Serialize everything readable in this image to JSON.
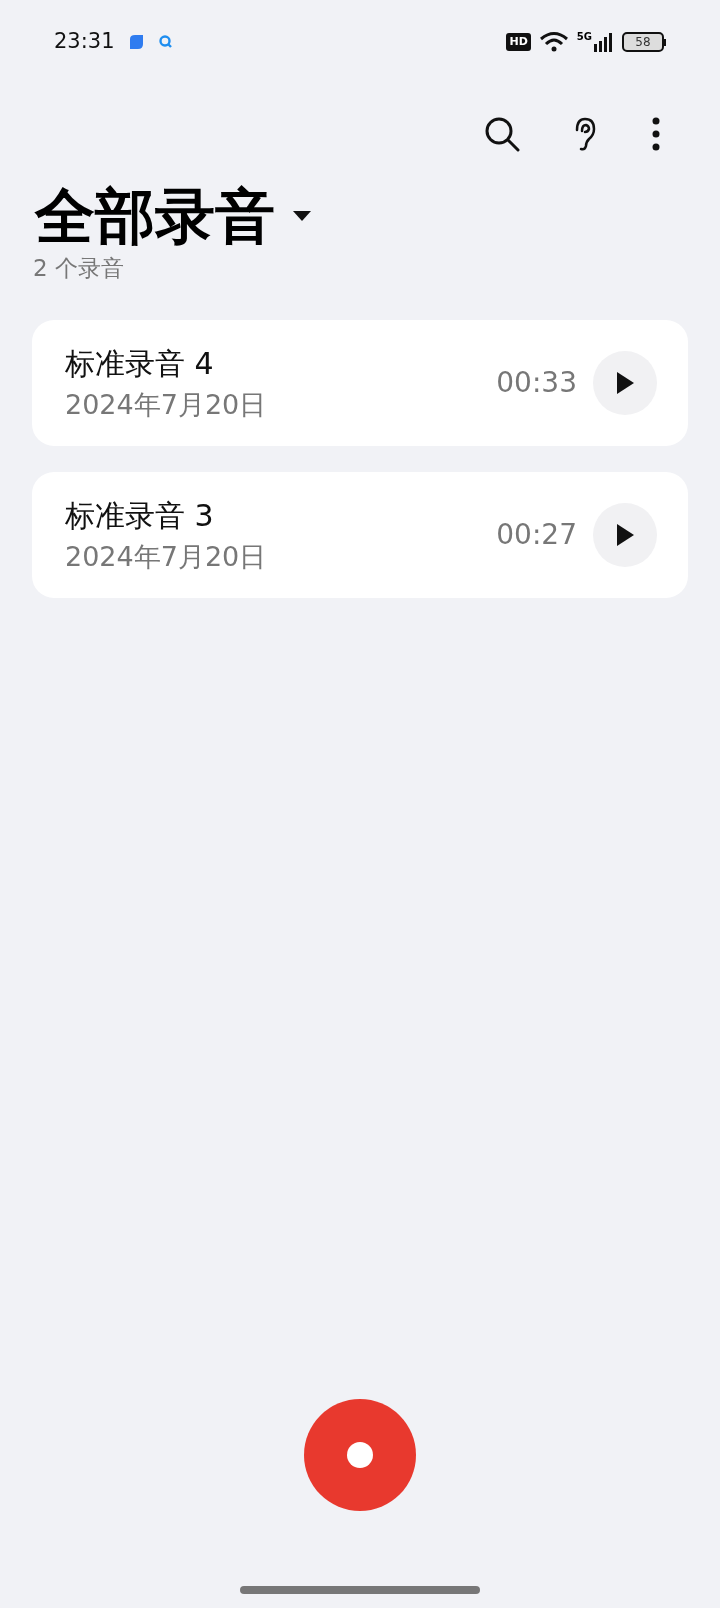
{
  "status_bar": {
    "time": "23:31",
    "hd": "HD",
    "network": "5G",
    "battery": "58"
  },
  "header": {
    "title": "全部录音",
    "count": "2 个录音"
  },
  "recordings": [
    {
      "name": "标准录音 4",
      "date": "2024年7月20日",
      "duration": "00:33"
    },
    {
      "name": "标准录音 3",
      "date": "2024年7月20日",
      "duration": "00:27"
    }
  ]
}
